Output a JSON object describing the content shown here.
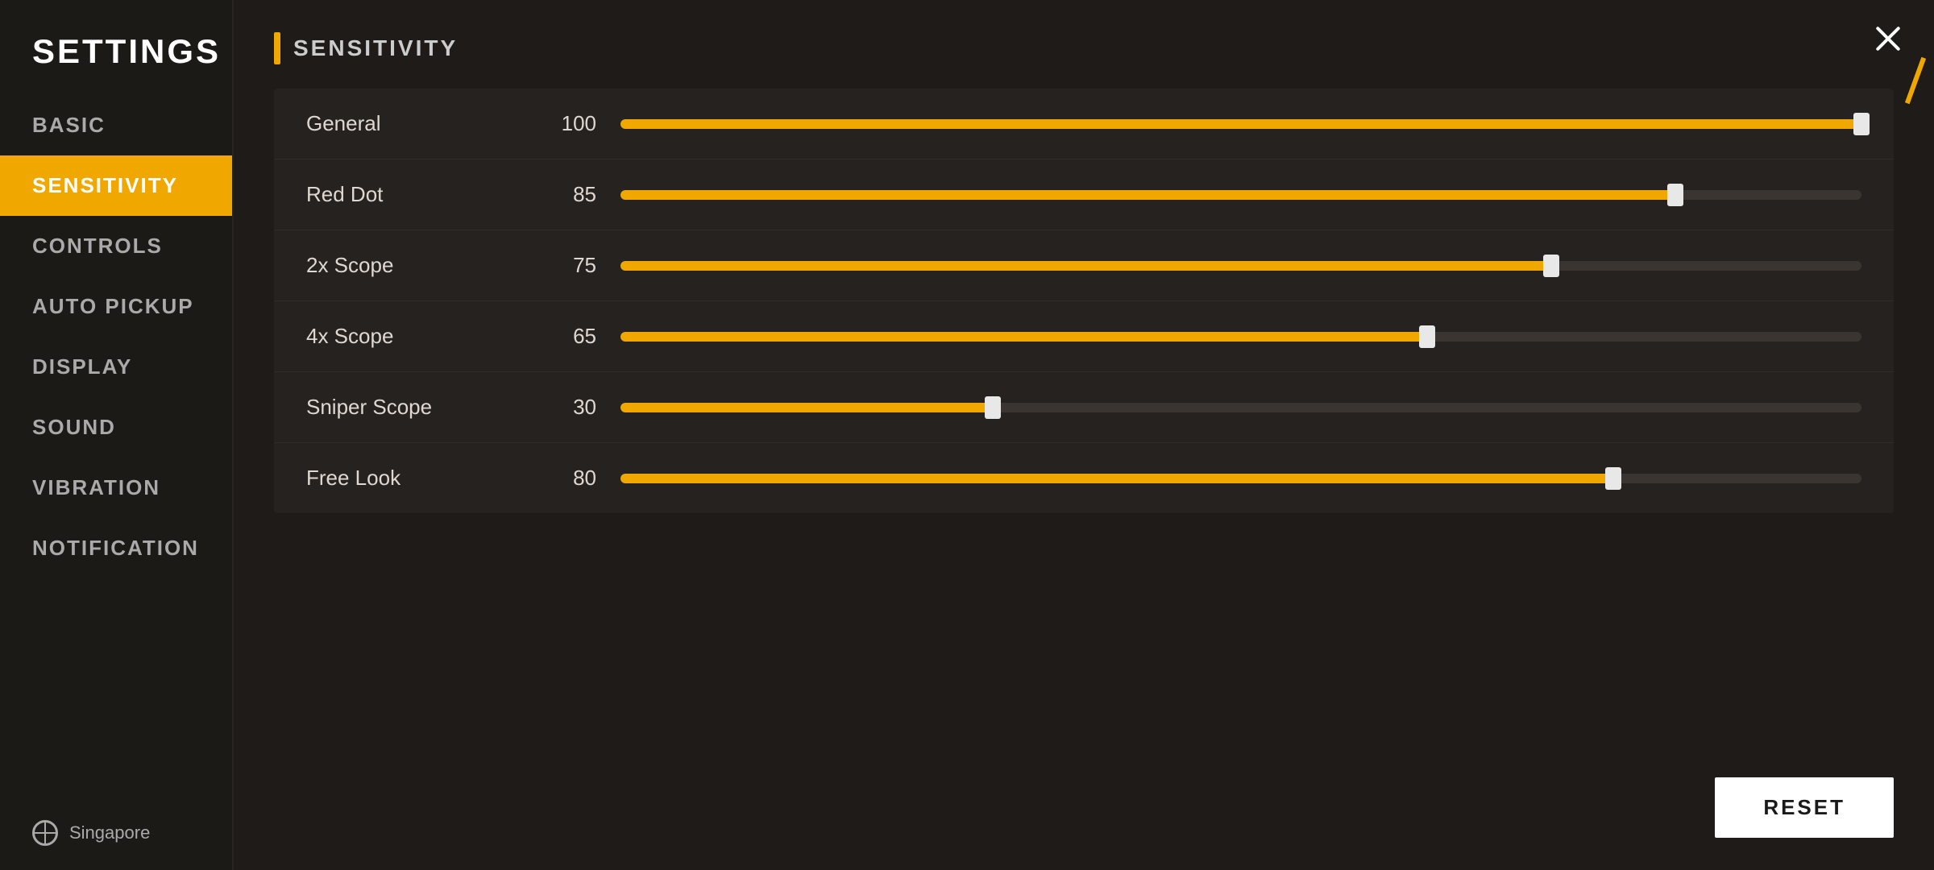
{
  "sidebar": {
    "title": "SETTINGS",
    "items": [
      {
        "id": "basic",
        "label": "BASIC",
        "active": false
      },
      {
        "id": "sensitivity",
        "label": "SENSITIVITY",
        "active": true
      },
      {
        "id": "controls",
        "label": "CONTROLS",
        "active": false
      },
      {
        "id": "auto-pickup",
        "label": "AUTO PICKUP",
        "active": false
      },
      {
        "id": "display",
        "label": "DISPLAY",
        "active": false
      },
      {
        "id": "sound",
        "label": "SOUND",
        "active": false
      },
      {
        "id": "vibration",
        "label": "VIBRATION",
        "active": false
      },
      {
        "id": "notification",
        "label": "NOTIFICATION",
        "active": false
      }
    ],
    "footer": {
      "region": "Singapore"
    }
  },
  "main": {
    "section_title": "SENSITIVITY",
    "sliders": [
      {
        "id": "general",
        "label": "General",
        "value": 100,
        "percent": 100
      },
      {
        "id": "red-dot",
        "label": "Red Dot",
        "value": 85,
        "percent": 85
      },
      {
        "id": "2x-scope",
        "label": "2x Scope",
        "value": 75,
        "percent": 75
      },
      {
        "id": "4x-scope",
        "label": "4x Scope",
        "value": 65,
        "percent": 65
      },
      {
        "id": "sniper-scope",
        "label": "Sniper Scope",
        "value": 30,
        "percent": 30
      },
      {
        "id": "free-look",
        "label": "Free Look",
        "value": 80,
        "percent": 80
      }
    ],
    "reset_button": "RESET"
  }
}
